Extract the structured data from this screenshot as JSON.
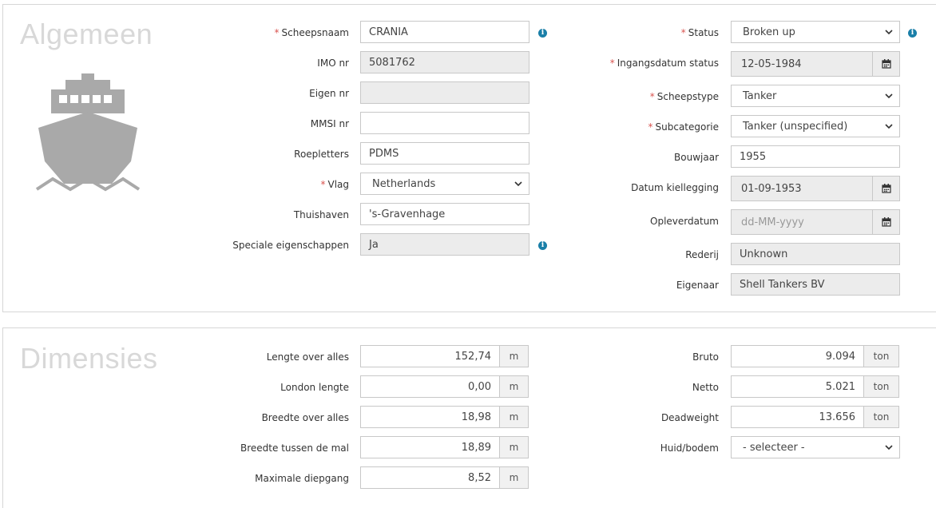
{
  "algemeen": {
    "title": "Algemeen",
    "left": {
      "scheepsnaam": {
        "label": "Scheepsnaam",
        "value": "CRANIA"
      },
      "imo": {
        "label": "IMO nr",
        "value": "5081762"
      },
      "eigen": {
        "label": "Eigen nr",
        "value": ""
      },
      "mmsi": {
        "label": "MMSI nr",
        "value": ""
      },
      "roepletters": {
        "label": "Roepletters",
        "value": "PDMS"
      },
      "vlag": {
        "label": "Vlag",
        "value": "Netherlands"
      },
      "thuishaven": {
        "label": "Thuishaven",
        "value": "'s-Gravenhage"
      },
      "speciale": {
        "label": "Speciale eigenschappen",
        "value": "Ja"
      }
    },
    "right": {
      "status": {
        "label": "Status",
        "value": "Broken up"
      },
      "ingangsdatum": {
        "label": "Ingangsdatum status",
        "value": "12-05-1984"
      },
      "scheepstype": {
        "label": "Scheepstype",
        "value": "Tanker"
      },
      "subcategorie": {
        "label": "Subcategorie",
        "value": "Tanker (unspecified)"
      },
      "bouwjaar": {
        "label": "Bouwjaar",
        "value": "1955"
      },
      "kiellegging": {
        "label": "Datum kiellegging",
        "value": "01-09-1953"
      },
      "oplever": {
        "label": "Opleverdatum",
        "placeholder": "dd-MM-yyyy"
      },
      "rederij": {
        "label": "Rederij",
        "value": "Unknown"
      },
      "eigenaar": {
        "label": "Eigenaar",
        "value": "Shell Tankers BV"
      }
    },
    "required_marker": "*",
    "ship_icon": "ship-icon",
    "info_icon": "info-icon",
    "calendar_icon": "calendar-icon"
  },
  "dimensies": {
    "title": "Dimensies",
    "left": {
      "loa": {
        "label": "Lengte over alles",
        "value": "152,74",
        "unit": "m"
      },
      "london": {
        "label": "London lengte",
        "value": "0,00",
        "unit": "m"
      },
      "breedte_alles": {
        "label": "Breedte over alles",
        "value": "18,98",
        "unit": "m"
      },
      "breedte_mal": {
        "label": "Breedte tussen de mal",
        "value": "18,89",
        "unit": "m"
      },
      "diepgang": {
        "label": "Maximale diepgang",
        "value": "8,52",
        "unit": "m"
      }
    },
    "right": {
      "bruto": {
        "label": "Bruto",
        "value": "9.094",
        "unit": "ton"
      },
      "netto": {
        "label": "Netto",
        "value": "5.021",
        "unit": "ton"
      },
      "deadweight": {
        "label": "Deadweight",
        "value": "13.656",
        "unit": "ton"
      },
      "huid": {
        "label": "Huid/bodem",
        "value": "- selecteer -"
      }
    }
  },
  "colors": {
    "required": "#d9534f",
    "info": "#1a7fa8",
    "readonly_bg": "#ececec",
    "heading": "#d8d8d8",
    "icon": "#a9a9a9"
  }
}
